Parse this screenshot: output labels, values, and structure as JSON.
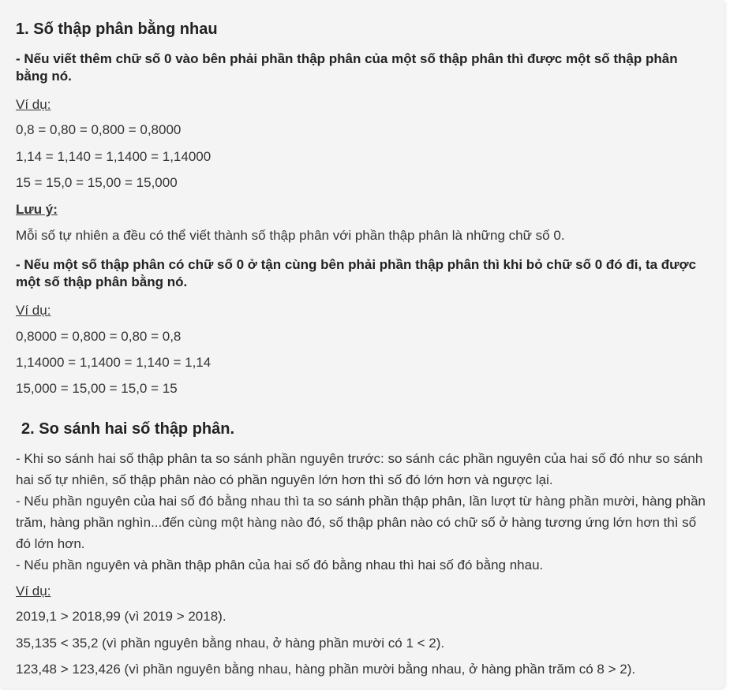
{
  "section1": {
    "title": "1. Số thập phân bằng nhau",
    "rule1": "- Nếu viết thêm chữ số 0 vào bên phải phần thập phân của một số thập phân thì được một số thập phân bằng nó.",
    "example_label": "Ví dụ:",
    "examples1": [
      "0,8 = 0,80 = 0,800 = 0,8000",
      "1,14 = 1,140 = 1,1400 = 1,14000",
      "15 = 15,0 = 15,00 = 15,000"
    ],
    "note_label": "Lưu ý:",
    "note_text": "Mỗi số tự nhiên a đều có thể viết thành số thập phân với phần thập phân là những chữ số 0.",
    "rule2": "- Nếu một số thập phân có chữ số 0 ở tận cùng bên phải phần thập phân thì khi bỏ chữ số 0 đó đi, ta được một số thập phân bằng nó.",
    "example_label2": "Ví dụ:",
    "examples2": [
      "0,8000 = 0,800 = 0,80 = 0,8",
      "1,14000 = 1,1400 = 1,140 = 1,14",
      "15,000 = 15,00 = 15,0 = 15"
    ]
  },
  "section2": {
    "title": "2. So sánh hai số thập phân.",
    "paragraphs": [
      "- Khi so sánh hai số thập phân ta so sánh phần nguyên trước: so sánh các phần nguyên của hai số đó như so sánh hai số tự nhiên, số thập phân nào có phần nguyên lớn hơn thì số đó lớn hơn và ngược lại.",
      "- Nếu phần nguyên của hai số đó bằng nhau thì ta so sánh phần thập phân, lần lượt từ hàng phần mười, hàng phần trăm, hàng phần nghìn...đến cùng một hàng nào đó, số thập phân nào có chữ số ở hàng tương ứng lớn hơn thì số đó lớn hơn.",
      "- Nếu phần nguyên và phần thập phân của hai số đó bằng nhau thì hai số đó bằng nhau."
    ],
    "example_label": "Ví dụ:",
    "examples": [
      "2019,1 > 2018,99 (vì 2019 > 2018).",
      "35,135 < 35,2 (vì phần nguyên bằng nhau, ở hàng phần mười có 1 < 2).",
      "123,48 > 123,426 (vì phần nguyên bằng nhau, hàng phần mười bằng nhau, ở hàng phần trăm có 8 > 2)."
    ]
  }
}
